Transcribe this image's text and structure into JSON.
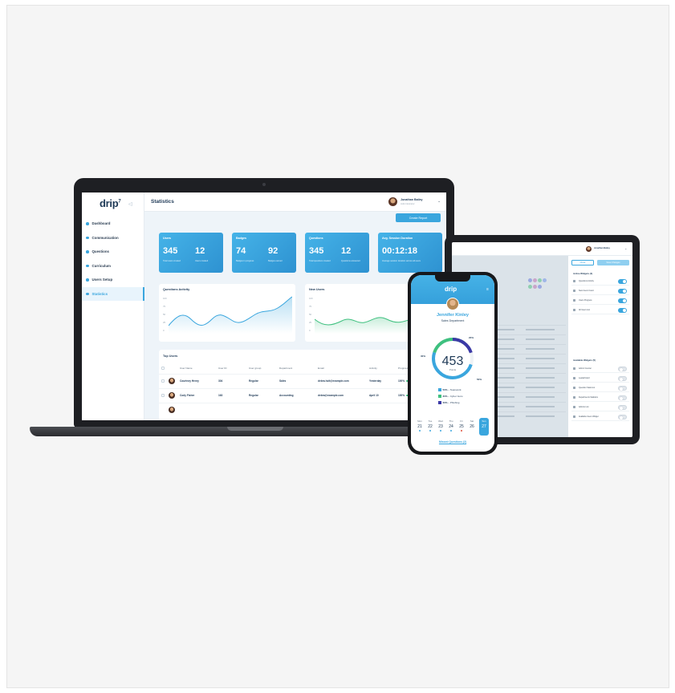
{
  "laptop": {
    "logo": "drip",
    "logo_sup": "7",
    "page_title": "Statistics",
    "user_name": "Jonathan Bailey",
    "user_role": "Administrator",
    "create_button": "Create Report",
    "nav": [
      {
        "label": "Dashboard"
      },
      {
        "label": "Communication"
      },
      {
        "label": "Questions"
      },
      {
        "label": "Curriculum"
      },
      {
        "label": "Users Setup"
      },
      {
        "label": "Statistics"
      }
    ],
    "stats": [
      {
        "title": "Users",
        "v1": "345",
        "v2": "12",
        "c1": "Total users created",
        "c2": "Users created"
      },
      {
        "title": "Badges",
        "v1": "74",
        "v2": "92",
        "c1": "Badges in progress",
        "c2": "Badges earned"
      },
      {
        "title": "Questions",
        "v1": "345",
        "v2": "12",
        "c1": "Total questions created",
        "c2": "Questions answered"
      },
      {
        "title": "Avg. Session Duration",
        "v1": "00:12:18",
        "v2": "",
        "c1": "Average session duration across all users",
        "c2": ""
      }
    ],
    "questions_activity": {
      "title": "Questions Activity",
      "ticks": [
        "100",
        "75",
        "50",
        "25",
        "0"
      ]
    },
    "new_users": {
      "title": "New Users",
      "ticks": [
        "100",
        "75",
        "50",
        "25",
        "0"
      ]
    },
    "top_users": {
      "title": "Top Users",
      "columns": [
        "User Name",
        "User ID",
        "User group",
        "Department",
        "Email",
        "Activity",
        "Progress"
      ],
      "rows": [
        {
          "name": "Courtney Henry",
          "id": "304",
          "group": "Regular",
          "dept": "Sales",
          "email": "debra.holt@example.com",
          "activity": "Yesterday",
          "progress": "100%"
        },
        {
          "name": "Cody Fisher",
          "id": "163",
          "group": "Regular",
          "dept": "Accounting",
          "email": "debra@example.com",
          "activity": "April 10",
          "progress": "100%"
        }
      ]
    }
  },
  "tablet": {
    "user_name": "Jonathan Bailey",
    "btn_cancel": "Close",
    "btn_save": "Save Changes",
    "active_title": "Active Widgets (4)",
    "active_widgets": [
      {
        "label": "Questions Activity"
      },
      {
        "label": "New Users Count"
      },
      {
        "label": "Users Progress"
      },
      {
        "label": "All Users List"
      }
    ],
    "available_title": "Available Widgets (5)",
    "available_widgets": [
      {
        "label": "Admin Counter"
      },
      {
        "label": "Leaderboard"
      },
      {
        "label": "Question Stats List"
      },
      {
        "label": "Departments Statistics"
      },
      {
        "label": "Admins List"
      },
      {
        "label": "Available Users Widget"
      }
    ]
  },
  "phone": {
    "logo": "drip",
    "user_name": "Jennifer Kinley",
    "department": "Sales Department",
    "points": "453",
    "points_label": "Points",
    "pct_top": "20%",
    "pct_left": "30%",
    "pct_right": "50%",
    "legend": [
      {
        "pct": "50%",
        "label": "Teamwork",
        "color": "#3aa6de"
      },
      {
        "pct": "30%",
        "label": "Cyber Guru",
        "color": "#3ec07f"
      },
      {
        "pct": "20%",
        "label": "Phishing",
        "color": "#3b39a6"
      }
    ],
    "calendar": [
      {
        "day": "Mon",
        "date": "21"
      },
      {
        "day": "Tue",
        "date": "22"
      },
      {
        "day": "Wed",
        "date": "23"
      },
      {
        "day": "Thu",
        "date": "24"
      },
      {
        "day": "Fri",
        "date": "25"
      },
      {
        "day": "Sat",
        "date": "26"
      },
      {
        "day": "Sun",
        "date": "27"
      }
    ],
    "link": "Missed Questions (2)"
  },
  "colors": {
    "accent": "#3aa6de",
    "green": "#3ec07f",
    "indigo": "#3b39a6",
    "navy": "#1f3a57"
  }
}
